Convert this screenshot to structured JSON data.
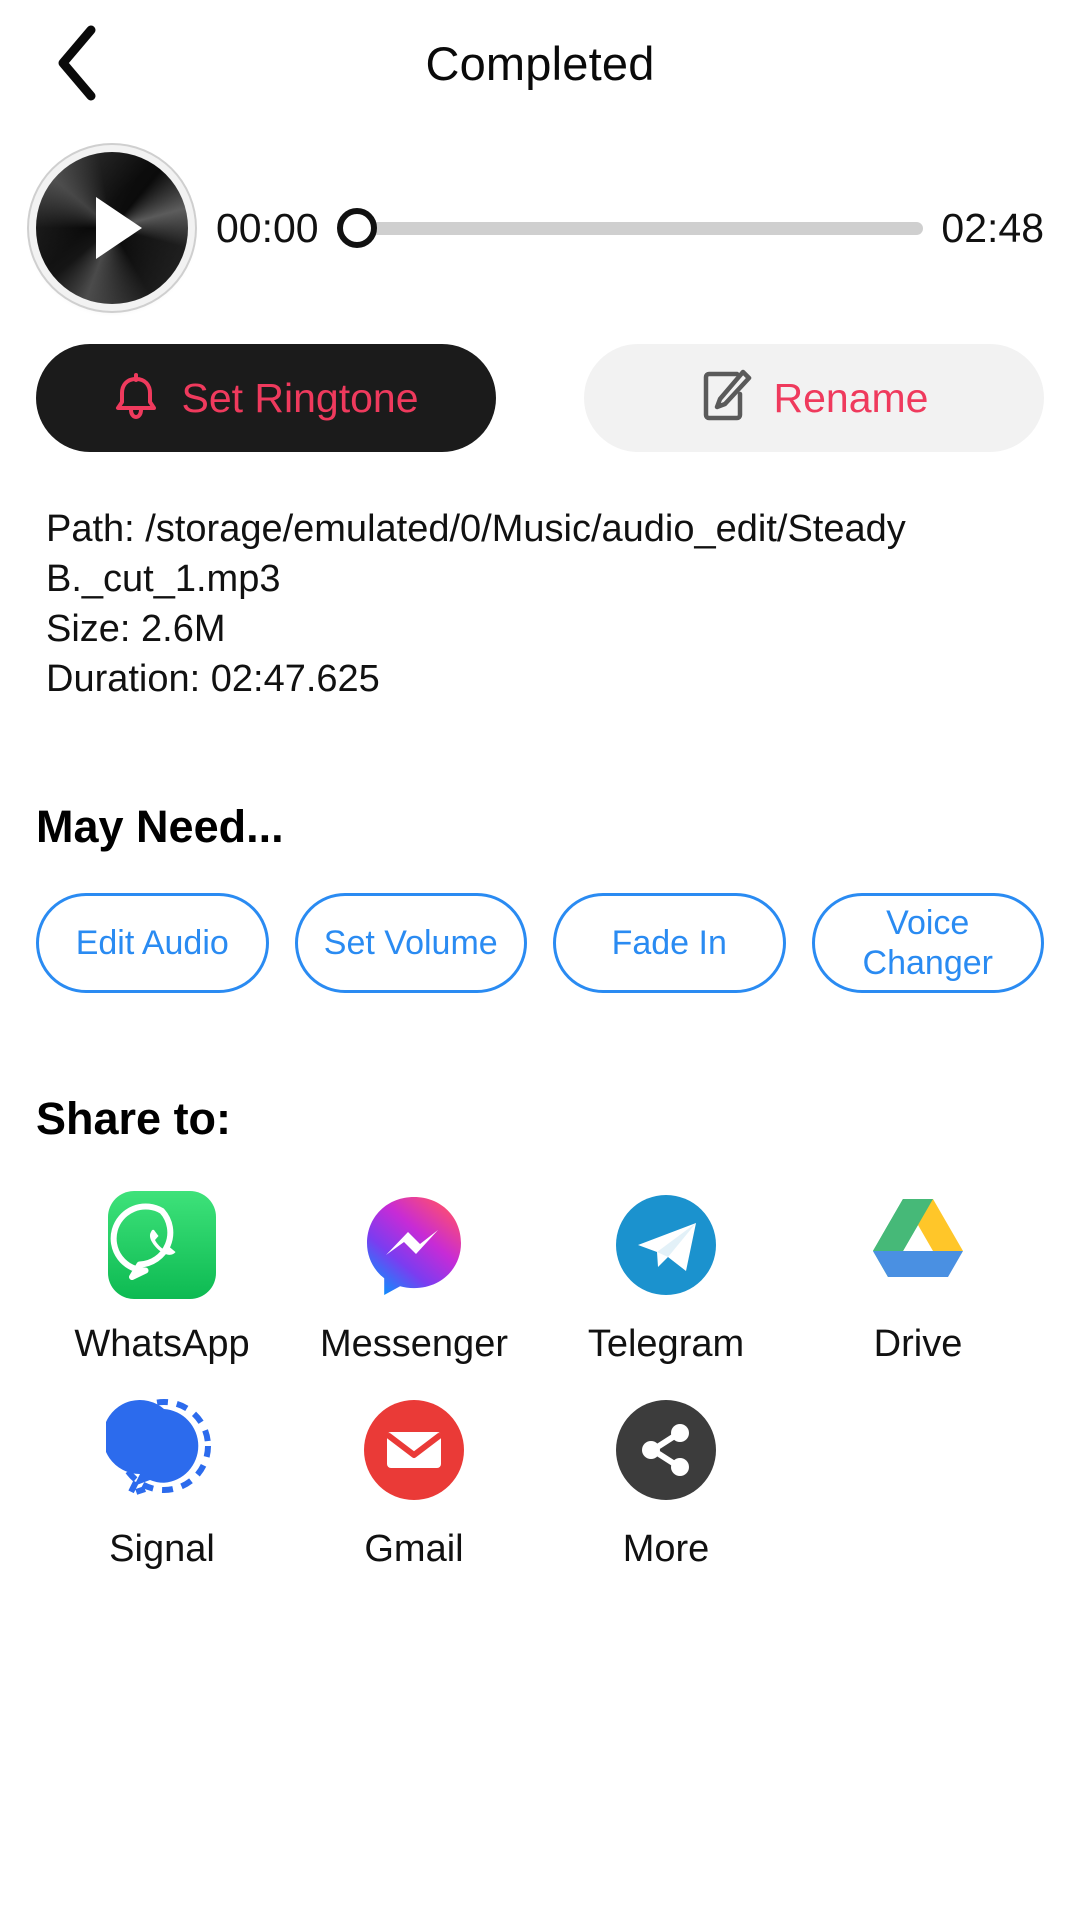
{
  "header": {
    "back_icon": "chevron-left-icon",
    "title": "Completed"
  },
  "player": {
    "play_icon": "play-icon",
    "current_time": "00:00",
    "total_time": "02:48",
    "progress_percent": 0
  },
  "actions": {
    "set_ringtone": {
      "label": "Set Ringtone",
      "icon": "bell-icon",
      "bg": "#1b1b1b",
      "text_color": "#ef3a5d"
    },
    "rename": {
      "label": "Rename",
      "icon": "edit-pencil-icon",
      "bg": "#f2f2f2",
      "text_color": "#ef3a5d"
    }
  },
  "file_info": {
    "path_line1": "Path: /storage/emulated/0/Music/audio_edit/Steady",
    "path_line2": "B._cut_1.mp3",
    "size": "Size: 2.6M",
    "duration": "Duration: 02:47.625"
  },
  "may_need": {
    "title": "May Need...",
    "accent": "#2a8bf2",
    "chips": [
      {
        "label": "Edit Audio"
      },
      {
        "label": "Set Volume"
      },
      {
        "label": "Fade In"
      },
      {
        "label": "Voice Changer"
      }
    ]
  },
  "share": {
    "title": "Share to:",
    "items": [
      {
        "label": "WhatsApp",
        "icon": "whatsapp-icon",
        "color": "#25D366"
      },
      {
        "label": "Messenger",
        "icon": "messenger-icon",
        "color": "#9B3EF5"
      },
      {
        "label": "Telegram",
        "icon": "telegram-icon",
        "color": "#1B92CE"
      },
      {
        "label": "Drive",
        "icon": "google-drive-icon",
        "color": "#FFC107"
      },
      {
        "label": "Signal",
        "icon": "signal-icon",
        "color": "#2C6BED"
      },
      {
        "label": "Gmail",
        "icon": "gmail-icon",
        "color": "#EA3A37"
      },
      {
        "label": "More",
        "icon": "share-nodes-icon",
        "color": "#3C3C3C"
      }
    ]
  }
}
